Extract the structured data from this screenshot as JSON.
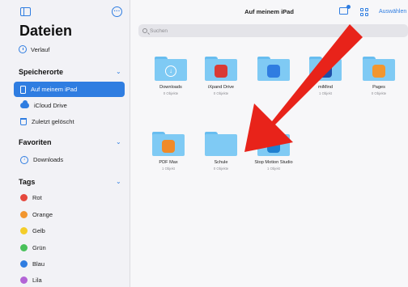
{
  "sidebar": {
    "title": "Dateien",
    "recent_label": "Verlauf",
    "locations_header": "Speicherorte",
    "locations": [
      {
        "label": "Auf meinem iPad"
      },
      {
        "label": "iCloud Drive"
      },
      {
        "label": "Zuletzt gelöscht"
      }
    ],
    "favorites_header": "Favoriten",
    "favorites": [
      {
        "label": "Downloads"
      }
    ],
    "tags_header": "Tags",
    "tags": [
      {
        "label": "Rot",
        "color": "#e5473d"
      },
      {
        "label": "Orange",
        "color": "#f2962f"
      },
      {
        "label": "Gelb",
        "color": "#f4cd2a"
      },
      {
        "label": "Grün",
        "color": "#49c15a"
      },
      {
        "label": "Blau",
        "color": "#2f7de1"
      },
      {
        "label": "Lila",
        "color": "#b364d6"
      }
    ]
  },
  "main": {
    "title": "Auf meinem iPad",
    "select_label": "Auswählen",
    "search_placeholder": "Suchen",
    "folders": [
      {
        "name": "Downloads",
        "count": "0 Objekte",
        "badge": "download-icon",
        "badge_color": "#7fcaf4"
      },
      {
        "name": "iXpand Drive",
        "count": "0 Objekte",
        "badge": "ixpand-app-icon",
        "badge_color": "#d93a35"
      },
      {
        "name": "",
        "count": "",
        "badge": "keynote-app-icon",
        "badge_color": "#2f7de1"
      },
      {
        "name": "miMind",
        "count": "1 Objekt",
        "badge": "mimind-app-icon",
        "badge_color": "#1f4fa8"
      },
      {
        "name": "Pages",
        "count": "0 Objekte",
        "badge": "pages-app-icon",
        "badge_color": "#f2962f"
      },
      {
        "name": "PDF Max",
        "count": "1 Objekt",
        "badge": "pdf-max-app-icon",
        "badge_color": "#f08a28"
      },
      {
        "name": "Schule",
        "count": "0 Objekte",
        "badge": "",
        "badge_color": ""
      },
      {
        "name": "Stop Motion Studio",
        "count": "1 Objekt",
        "badge": "stop-motion-app-icon",
        "badge_color": "#1e7fd0"
      }
    ]
  },
  "overlay": {
    "arrow_color": "#e8231a"
  },
  "accent_color": "#2f7de1"
}
